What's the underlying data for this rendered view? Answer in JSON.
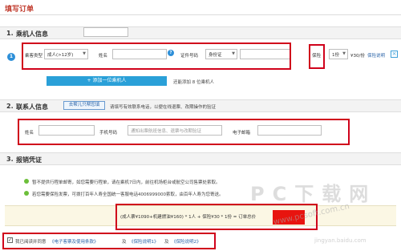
{
  "page": {
    "title": "填写订单"
  },
  "passenger": {
    "number": "1.",
    "title": "乘机人信息",
    "type_label": "乘客类型",
    "type_value": "成人(>12岁)",
    "name_label": "姓名",
    "id_type_label": "证件号码",
    "id_type_value": "身份证",
    "insurance_label": "保险",
    "insurance_qty": "1份",
    "insurance_price": "¥30/份",
    "insurance_link": "保险说明",
    "add_button": "+ 添加一位乘机人",
    "add_hint": "还能添加 8 位乘机人"
  },
  "contact": {
    "number": "2.",
    "title": "联系人信息",
    "help_button": "去帮儿只帮您填",
    "hint": "请填写有效联系电话，以便在线退票、改期操作的验证",
    "name_label": "姓名",
    "phone_label": "手机号码",
    "phone_placeholder": "通知出票航班信息、退票与改期验证",
    "email_label": "电子邮箱"
  },
  "receipt": {
    "number": "3.",
    "title": "报销凭证",
    "line1": "暂不提供行程单邮寄，如您需要行程单，请在乘机7日内，前往机场柜台或航空公司售票处索取。",
    "line2": "若您需要保险发票，可拨打百年人寿全国统一客服电话4006999000索取，由百年人寿为您寄送。"
  },
  "price": {
    "breakdown": "(成人票¥1090+机建燃油¥160) * 1人 + 保险¥30 * 1份 = 订单总价"
  },
  "agreement": {
    "prefix": "我已阅读并同意",
    "link1": "《电子客票及使用条款》",
    "and1": "及",
    "link2": "《保险说明1》",
    "and2": "及",
    "link3": "《保险说明2》"
  },
  "watermark": {
    "main": "PC下载网",
    "url": "www.pcsoft.com.cn",
    "small": "jingyan.baidu.com"
  },
  "colors": {
    "accent_red": "#d0021b",
    "brand_blue": "#2aa0d8",
    "page_title_red": "#c0392b",
    "check_green": "#6cbf3a"
  }
}
